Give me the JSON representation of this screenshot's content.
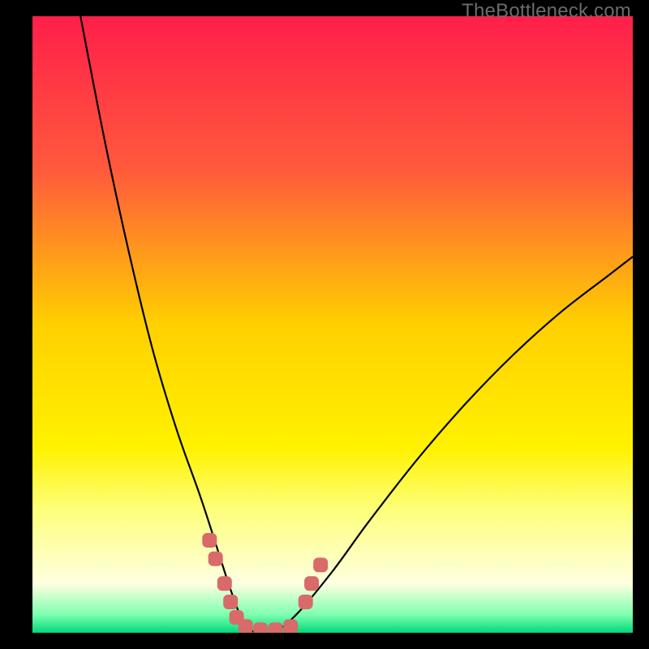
{
  "watermark": "TheBottleneck.com",
  "chart_data": {
    "type": "line",
    "title": "",
    "xlabel": "",
    "ylabel": "",
    "xlim": [
      0,
      100
    ],
    "ylim": [
      0,
      100
    ],
    "background_gradient_stops": [
      {
        "offset": 0,
        "color": "#ff1f4a"
      },
      {
        "offset": 0.25,
        "color": "#ff5a3c"
      },
      {
        "offset": 0.5,
        "color": "#ffd000"
      },
      {
        "offset": 0.7,
        "color": "#fff200"
      },
      {
        "offset": 0.8,
        "color": "#fdff7a"
      },
      {
        "offset": 0.92,
        "color": "#ffffe0"
      },
      {
        "offset": 0.97,
        "color": "#7fffb0"
      },
      {
        "offset": 1.0,
        "color": "#00d97a"
      }
    ],
    "highlighted_band_y": [
      0,
      4
    ],
    "min_x": 37,
    "series": [
      {
        "name": "left",
        "x": [
          8,
          12,
          16,
          20,
          24,
          28,
          31,
          33,
          35,
          37
        ],
        "y": [
          100,
          80,
          62,
          46,
          33,
          22,
          13,
          7,
          2,
          0
        ]
      },
      {
        "name": "right",
        "x": [
          37,
          40,
          44,
          50,
          56,
          64,
          72,
          80,
          88,
          96,
          100
        ],
        "y": [
          0,
          0,
          3,
          10,
          18,
          28,
          37,
          45,
          52,
          58,
          61
        ]
      }
    ],
    "markers": [
      {
        "x": 29.5,
        "y": 15
      },
      {
        "x": 30.5,
        "y": 12
      },
      {
        "x": 32.0,
        "y": 8
      },
      {
        "x": 33.0,
        "y": 5
      },
      {
        "x": 34.0,
        "y": 2.5
      },
      {
        "x": 35.5,
        "y": 1
      },
      {
        "x": 38.0,
        "y": 0.5
      },
      {
        "x": 40.5,
        "y": 0.5
      },
      {
        "x": 43.0,
        "y": 1
      },
      {
        "x": 45.5,
        "y": 5
      },
      {
        "x": 46.5,
        "y": 8
      },
      {
        "x": 48.0,
        "y": 11
      }
    ]
  }
}
